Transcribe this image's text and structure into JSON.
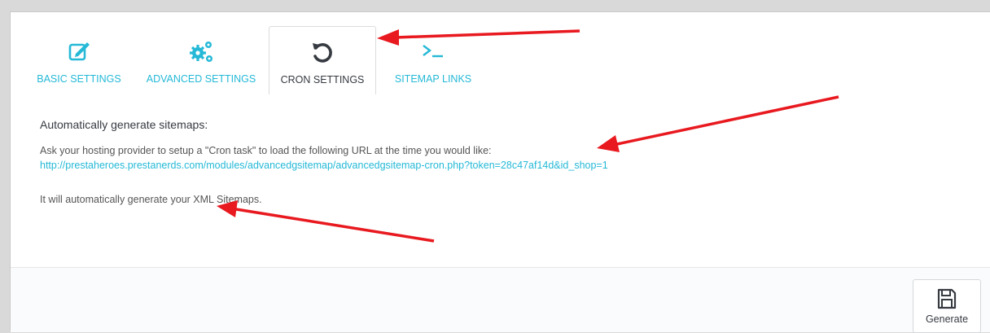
{
  "tabs": [
    {
      "label": "BASIC SETTINGS",
      "icon": "edit-icon",
      "active": false
    },
    {
      "label": "ADVANCED SETTINGS",
      "icon": "gears-icon",
      "active": false
    },
    {
      "label": "CRON SETTINGS",
      "icon": "refresh-icon",
      "active": true
    },
    {
      "label": "SITEMAP LINKS",
      "icon": "terminal-icon",
      "active": false
    }
  ],
  "content": {
    "heading": "Automatically generate sitemaps:",
    "instruction": "Ask your hosting provider to setup a \"Cron task\" to load the following URL at the time you would like:",
    "cron_url": "http://prestaheroes.prestanerds.com/modules/advancedgsitemap/advancedgsitemap-cron.php?token=28c47af14d&id_shop=1",
    "note": "It will automatically generate your XML Sitemaps."
  },
  "footer": {
    "generate_label": "Generate",
    "generate_icon": "save-icon"
  },
  "colors": {
    "accent": "#25b9d7",
    "text": "#555555",
    "annotation_arrow": "#e8191f"
  }
}
